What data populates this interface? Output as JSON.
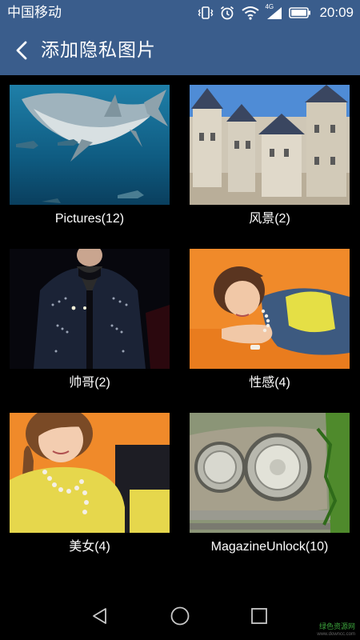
{
  "status_bar": {
    "carrier": "中国移动",
    "network_type": "4G",
    "time": "20:09",
    "icons": [
      "vibrate-icon",
      "alarm-icon",
      "wifi-icon",
      "cellular-signal-icon",
      "battery-icon"
    ]
  },
  "header": {
    "back_icon": "chevron-left-icon",
    "title": "添加隐私图片",
    "color": "#3a5d8c"
  },
  "albums": [
    {
      "label": "Pictures(12)",
      "thumbnail": "shark underwater photo"
    },
    {
      "label": "风景(2)",
      "thumbnail": "castle photo"
    },
    {
      "label": "帅哥(2)",
      "thumbnail": "man in studded jacket photo"
    },
    {
      "label": "性感(4)",
      "thumbnail": "woman lying on orange background photo"
    },
    {
      "label": "美女(4)",
      "thumbnail": "smiling woman in yellow photo"
    },
    {
      "label": "MagazineUnlock(10)",
      "thumbnail": "car headlights photo"
    }
  ],
  "nav_bar": {
    "icons": [
      "back-triangle-icon",
      "home-circle-icon",
      "recents-square-icon"
    ]
  },
  "watermark": {
    "text": "绿色资源网",
    "url": "www.downcc.com"
  }
}
